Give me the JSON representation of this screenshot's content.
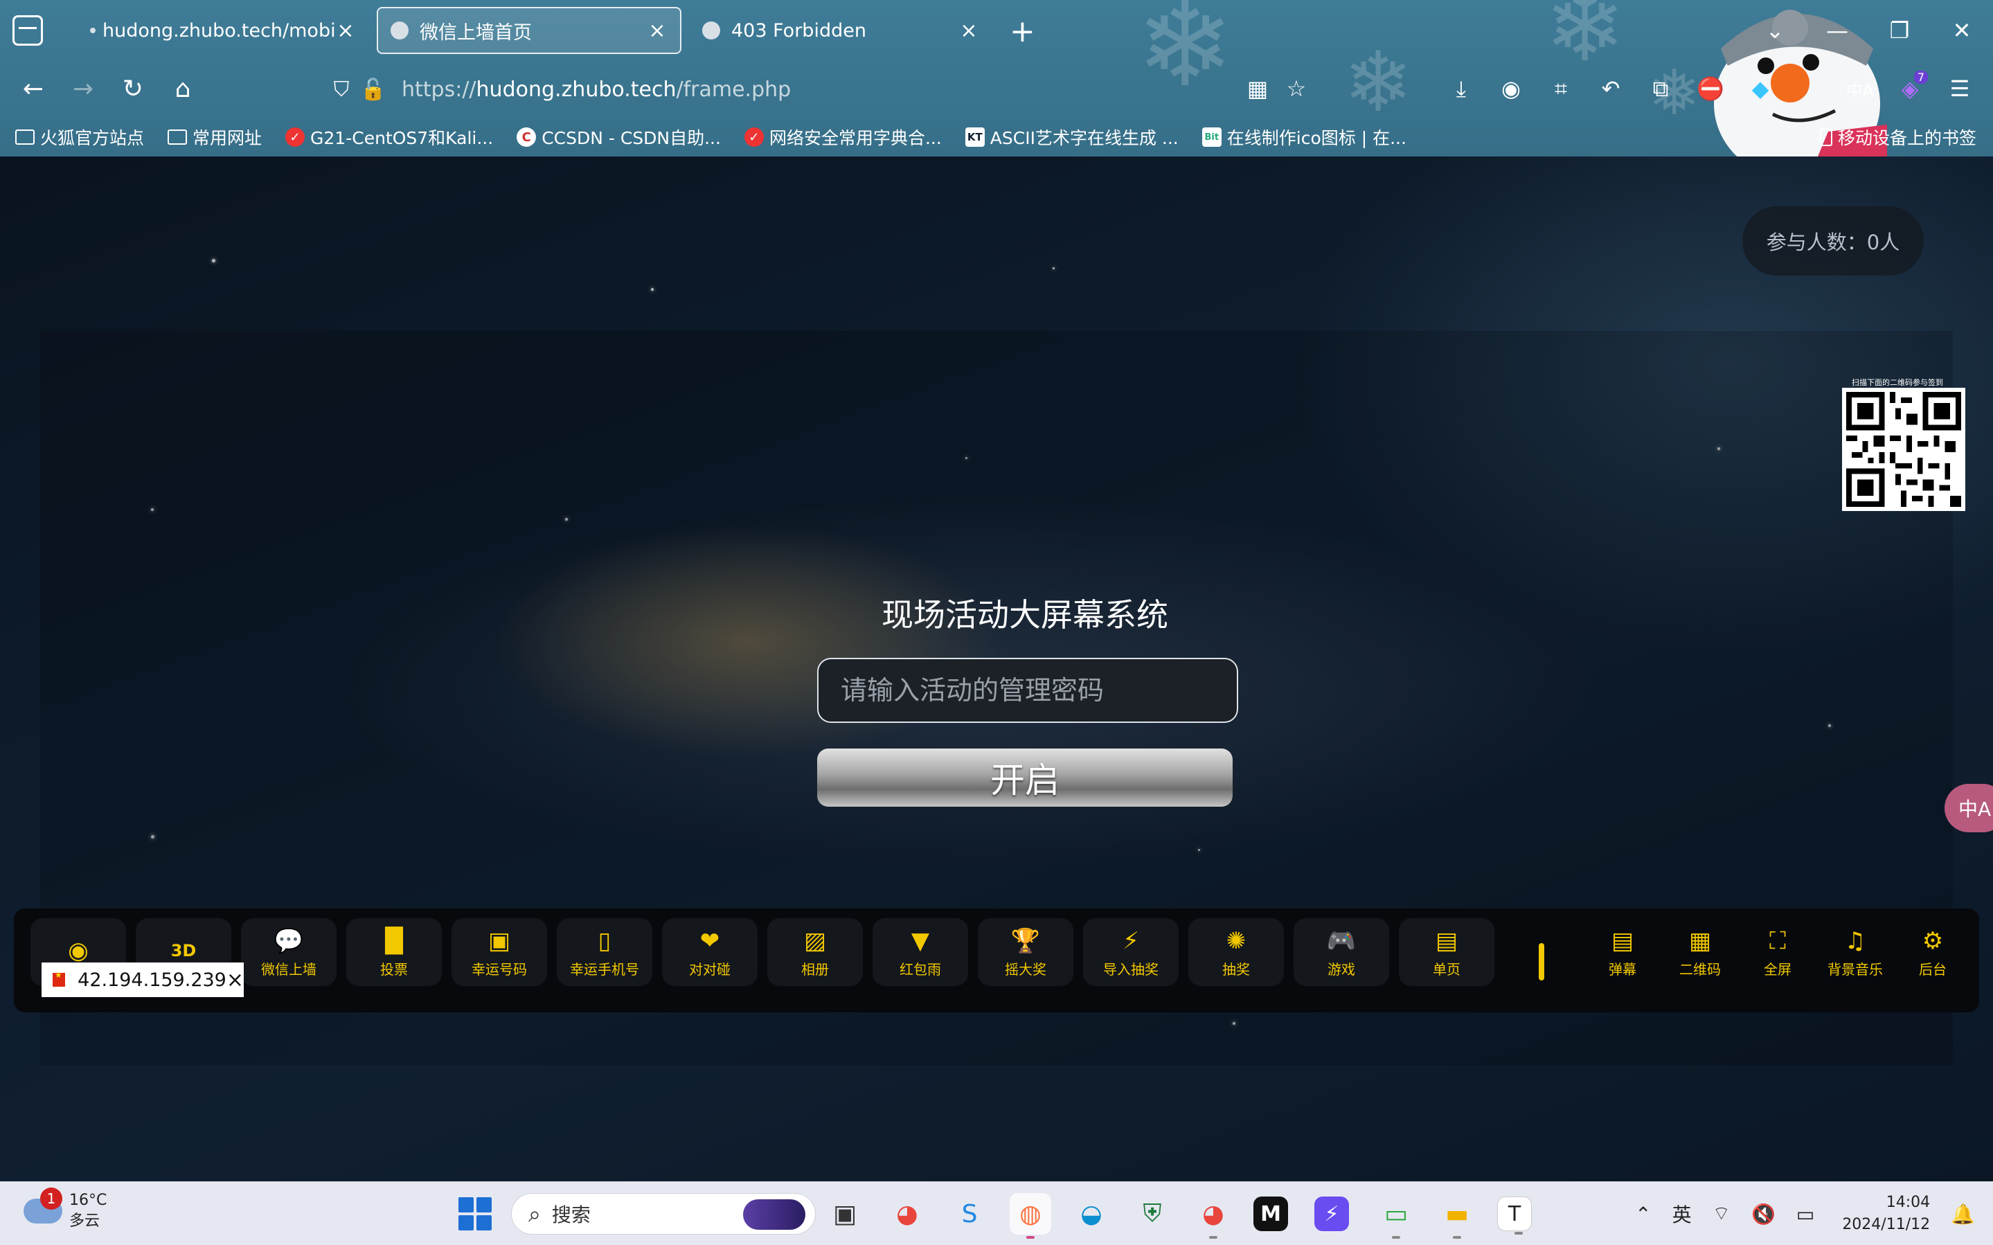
{
  "browser": {
    "tabs": [
      {
        "title": "hudong.zhubo.tech/mobile/i",
        "active": false
      },
      {
        "title": "微信上墙首页",
        "active": true
      },
      {
        "title": "403 Forbidden",
        "active": false
      }
    ],
    "url": {
      "prefix": "https://",
      "host": "hudong.zhubo.tech",
      "path": "/frame.php"
    },
    "extension_badge": "7",
    "bookmarks": [
      {
        "label": "火狐官方站点",
        "icon": "folder-icon"
      },
      {
        "label": "常用网址",
        "icon": "folder-icon"
      },
      {
        "label": "G21-CentOS7和Kali...",
        "icon": "red-shield-icon"
      },
      {
        "label": "CCSDN - CSDN自助...",
        "icon": "cc-icon"
      },
      {
        "label": "网络安全常用字典合...",
        "icon": "red-shield-icon"
      },
      {
        "label": "ASCII艺术字在线生成 ...",
        "icon": "kt-icon"
      },
      {
        "label": "在线制作ico图标 | 在...",
        "icon": "bit-icon"
      }
    ],
    "mobile_bookmarks": "移动设备上的书签"
  },
  "page": {
    "participants": "参与人数：0人",
    "qr_caption": "扫描下面的二维码参与签到",
    "login": {
      "title": "现场活动大屏幕系统",
      "password_placeholder": "请输入活动的管理密码",
      "submit": "开启"
    },
    "translate_icon": "中A",
    "toolbar": [
      {
        "label": "",
        "icon": "pin-icon"
      },
      {
        "label": "",
        "icon": "3d-icon"
      },
      {
        "label": "微信上墙",
        "icon": "wechat-icon"
      },
      {
        "label": "投票",
        "icon": "bar-chart-icon"
      },
      {
        "label": "幸运号码",
        "icon": "lucky-number-icon"
      },
      {
        "label": "幸运手机号",
        "icon": "phone-icon"
      },
      {
        "label": "对对碰",
        "icon": "hearts-icon"
      },
      {
        "label": "相册",
        "icon": "photo-icon"
      },
      {
        "label": "红包雨",
        "icon": "red-packet-icon"
      },
      {
        "label": "摇大奖",
        "icon": "trophy-icon"
      },
      {
        "label": "导入抽奖",
        "icon": "import-lottery-icon"
      },
      {
        "label": "抽奖",
        "icon": "wheel-icon"
      },
      {
        "label": "游戏",
        "icon": "gamepad-icon"
      },
      {
        "label": "单页",
        "icon": "document-icon"
      },
      {
        "label": "弹幕",
        "icon": "danmaku-icon"
      },
      {
        "label": "二维码",
        "icon": "qrcode-icon"
      },
      {
        "label": "全屏",
        "icon": "fullscreen-icon"
      },
      {
        "label": "背景音乐",
        "icon": "music-icon"
      },
      {
        "label": "后台",
        "icon": "gear-icon"
      }
    ],
    "ip_address": "42.194.159.239"
  },
  "taskbar": {
    "weather": {
      "temp": "16°C",
      "condition": "多云",
      "badge": "1"
    },
    "search_placeholder": "搜索",
    "ime": "英",
    "time": "14:04",
    "date": "2024/11/12"
  },
  "colors": {
    "accent": "#f2c800",
    "toolbar_bg": "#07090c",
    "chrome": "#3b7690"
  }
}
